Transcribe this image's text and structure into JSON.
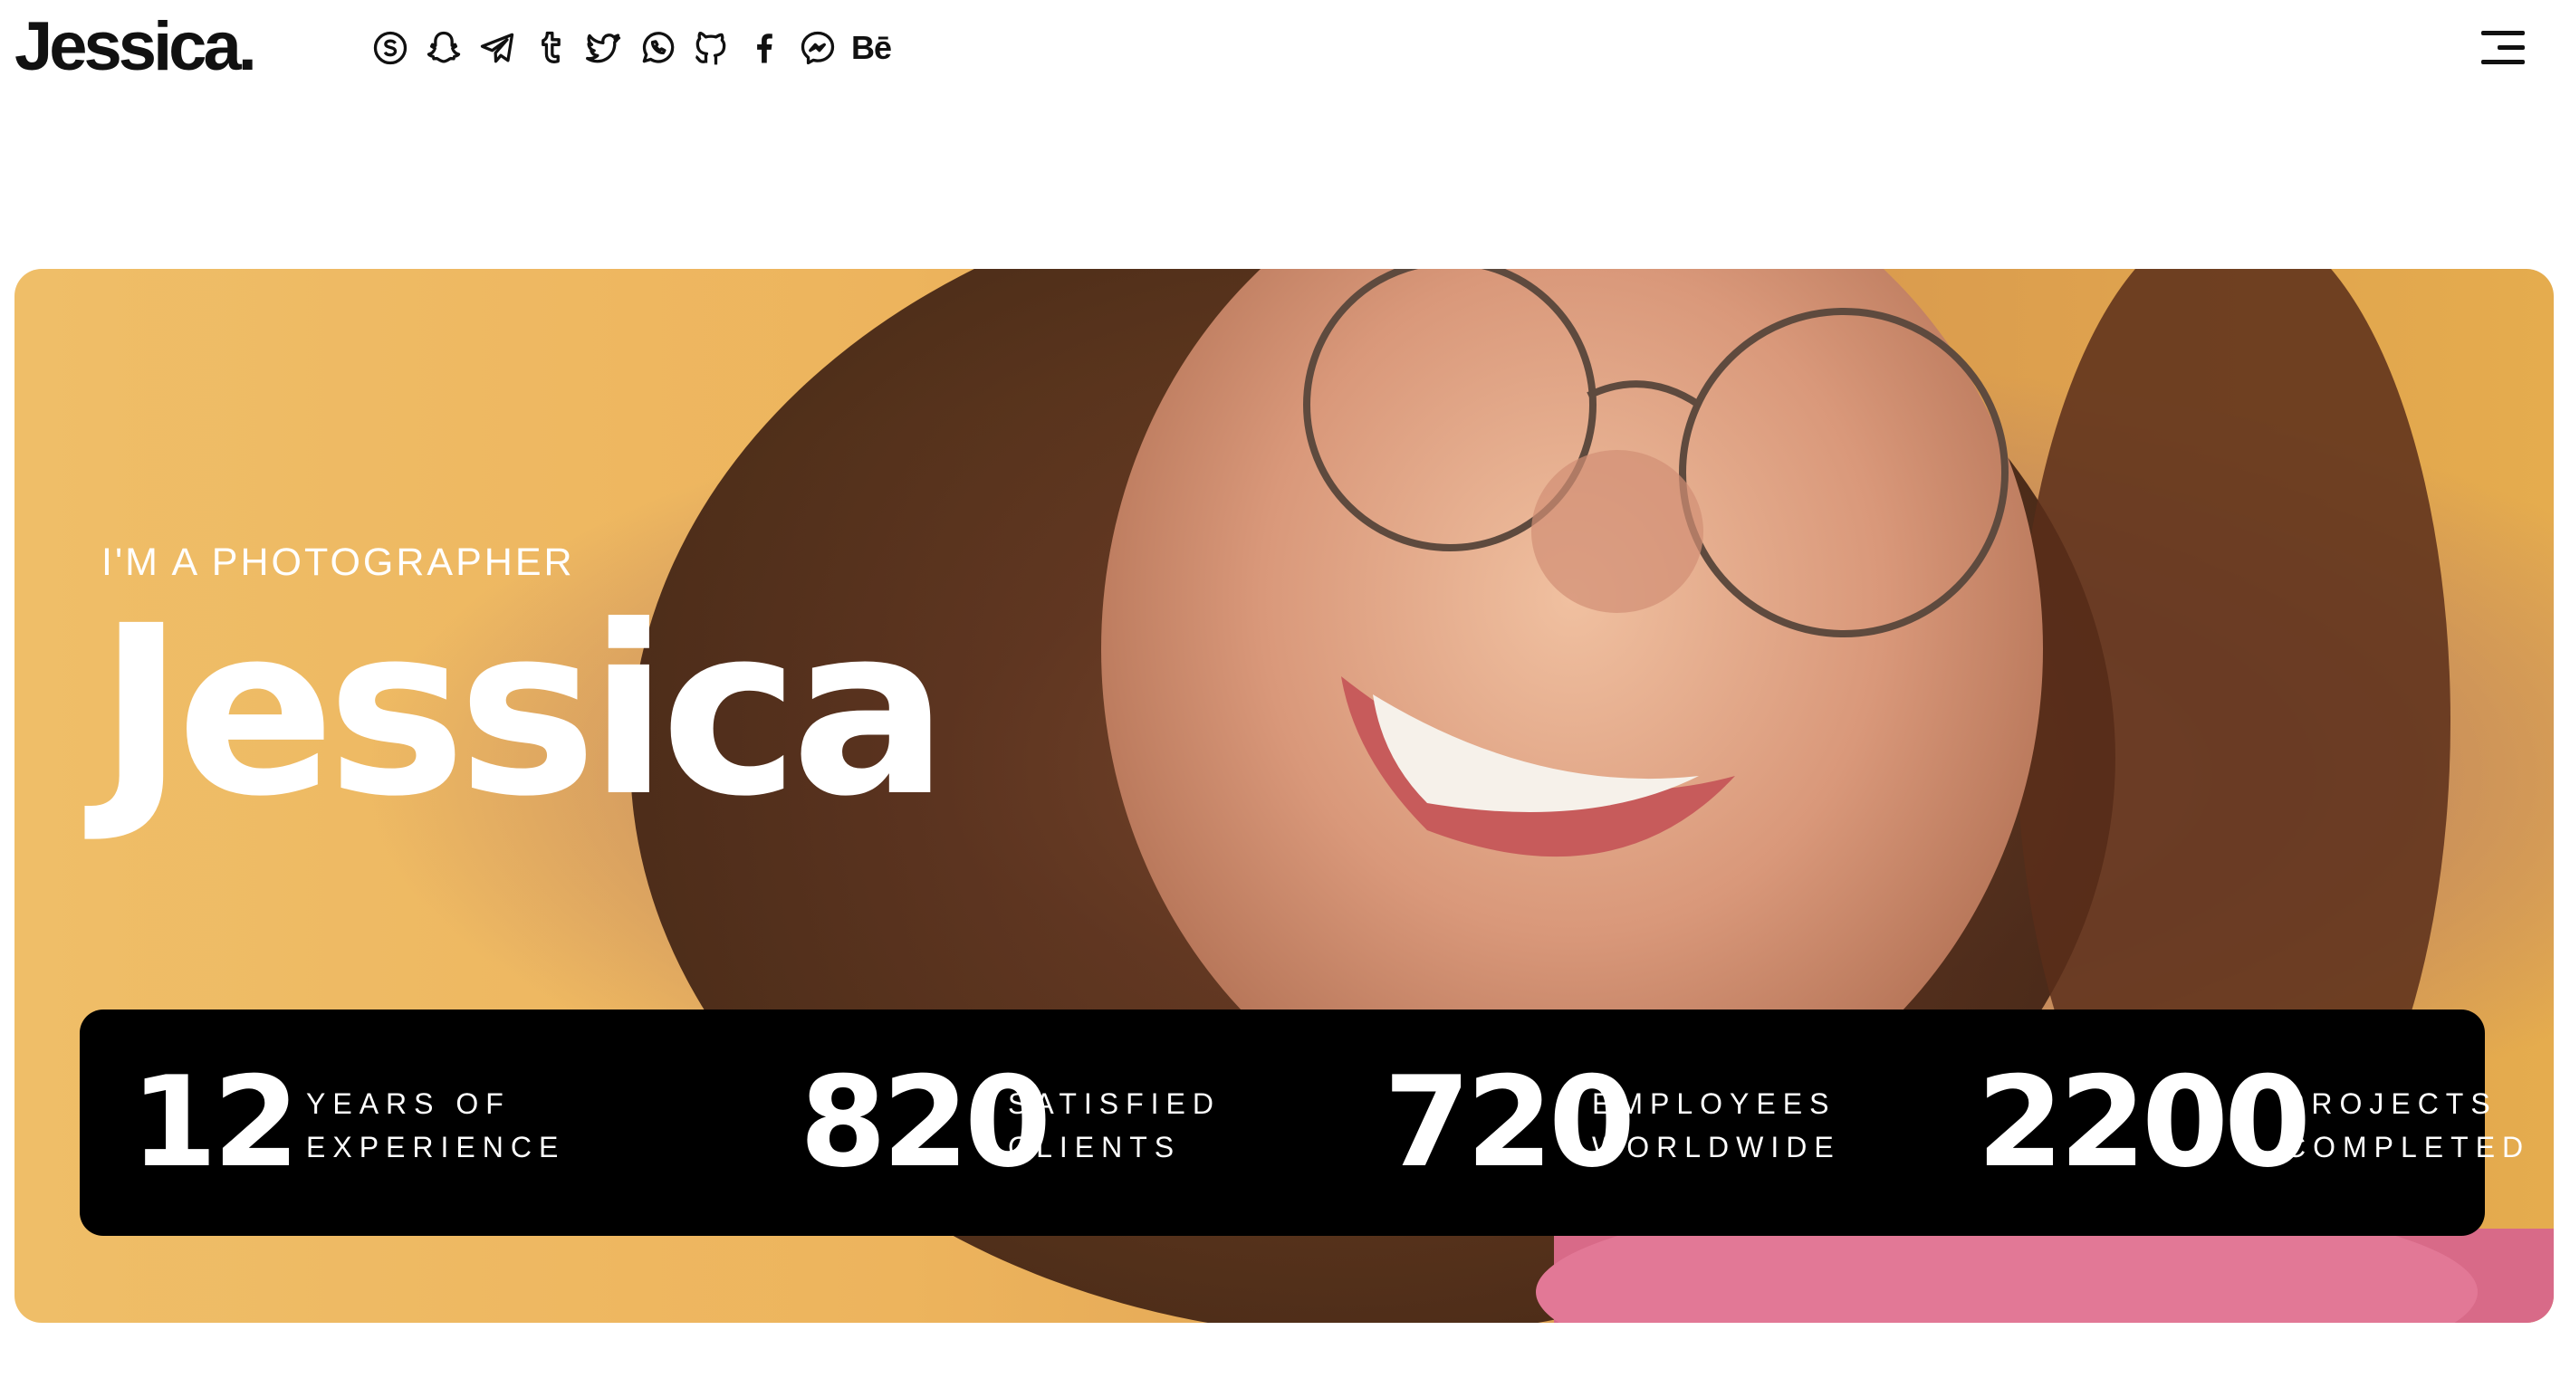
{
  "brand": {
    "logo_text": "Jessica."
  },
  "socials": [
    {
      "icon": "skype-icon"
    },
    {
      "icon": "snapchat-icon"
    },
    {
      "icon": "telegram-icon"
    },
    {
      "icon": "tumblr-icon"
    },
    {
      "icon": "twitter-icon"
    },
    {
      "icon": "whatsapp-icon"
    },
    {
      "icon": "github-icon"
    },
    {
      "icon": "facebook-icon"
    },
    {
      "icon": "messenger-icon"
    },
    {
      "icon": "behance-icon",
      "text": "Bē"
    }
  ],
  "menu": {
    "icon": "hamburger-menu-icon"
  },
  "hero": {
    "eyebrow": "I'M A PHOTOGRAPHER",
    "name": "Jessica",
    "background_color": "#edb45d"
  },
  "stats": [
    {
      "value": "12",
      "label_line1": "YEARS OF",
      "label_line2": "EXPERIENCE"
    },
    {
      "value": "820",
      "label_line1": "SATISFIED",
      "label_line2": "CLIENTS"
    },
    {
      "value": "720",
      "label_line1": "EMPLOYEES",
      "label_line2": "WORLDWIDE"
    },
    {
      "value": "2200",
      "label_line1": "PROJECTS",
      "label_line2": "COMPLETED"
    }
  ],
  "colors": {
    "stats_bar": "#000000",
    "text_light": "#ffffff",
    "text_dark": "#111111"
  }
}
